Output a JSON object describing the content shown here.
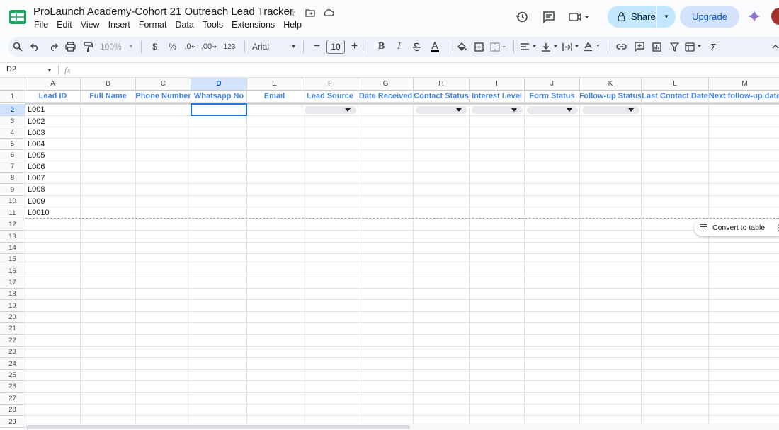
{
  "app": {
    "document_title": "ProLaunch Academy-Cohort 21 Outreach Lead Tracker",
    "menu": [
      "File",
      "Edit",
      "View",
      "Insert",
      "Format",
      "Data",
      "Tools",
      "Extensions",
      "Help"
    ],
    "share_label": "Share",
    "upgrade_label": "Upgrade"
  },
  "toolbar": {
    "zoom": "100%",
    "currency_label": "$",
    "percent_label": "%",
    "decrease_decimal_label": ".0",
    "increase_decimal_label": ".00",
    "number_format_label": "123",
    "font_family": "Arial",
    "font_size": "10",
    "bold_label": "B",
    "italic_label": "I",
    "sum_label": "Σ"
  },
  "formula_bar": {
    "name_box": "D2",
    "fx_label": "fx",
    "value": ""
  },
  "sheet": {
    "columns": [
      "A",
      "B",
      "C",
      "D",
      "E",
      "F",
      "G",
      "H",
      "I",
      "J",
      "K",
      "L",
      "M"
    ],
    "selected_column": "D",
    "selected_row": 2,
    "headers": [
      "Lead ID",
      "Full Name",
      "Phone Number",
      "Whatsapp No",
      "Email",
      "Lead Source",
      "Date Received",
      "Contact Status",
      "Interest Level",
      "Form Status",
      "Follow-up Status",
      "Last Contact Date",
      "Next follow-up date"
    ],
    "lead_ids": [
      "L001",
      "L002",
      "L003",
      "L004",
      "L005",
      "L006",
      "L007",
      "L008",
      "L009",
      "L0010"
    ],
    "row_numbers": [
      "1",
      "2",
      "3",
      "4",
      "5",
      "6",
      "7",
      "8",
      "9",
      "10",
      "11",
      "12",
      "13",
      "14",
      "15",
      "16",
      "17",
      "18",
      "19",
      "20",
      "21",
      "22",
      "23",
      "24",
      "25",
      "26",
      "27",
      "28",
      "29"
    ],
    "dropdown_columns": [
      "F",
      "H",
      "I",
      "J",
      "K"
    ]
  },
  "convert_to_table": {
    "label": "Convert to table"
  },
  "colors": {
    "header_text": "#4a86e8",
    "selection": "#1a73e8",
    "share_bg": "#c2e7ff",
    "upgrade_bg": "#d3e3fd"
  }
}
